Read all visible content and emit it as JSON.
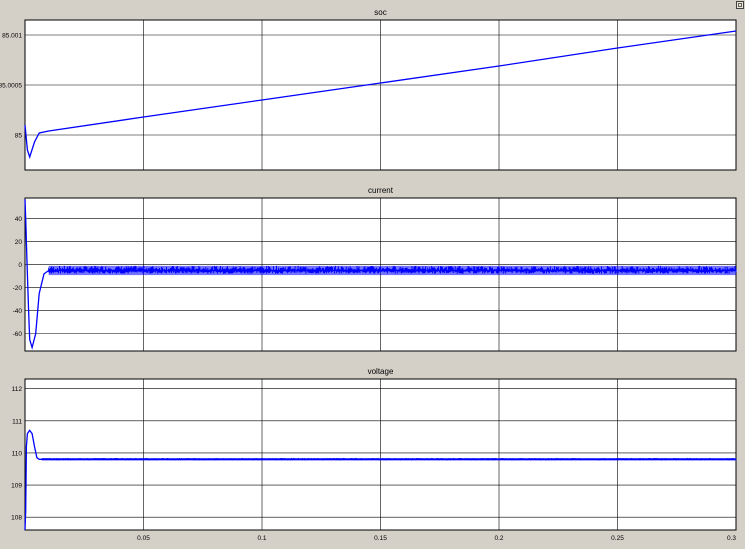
{
  "window": {
    "corner_icon": "restore-icon"
  },
  "colors": {
    "background": "#d4d0c8",
    "plot_bg": "#ffffff",
    "grid": "#000000",
    "trace": "#0000ff"
  },
  "x_ticks": [
    "0.05",
    "0.1",
    "0.15",
    "0.2",
    "0.25",
    "0.3"
  ],
  "chart_data": [
    {
      "type": "line",
      "title": "soc",
      "xlim": [
        0,
        0.3
      ],
      "ylim": [
        84.99965,
        85.00115
      ],
      "yticks": [
        85,
        85.0005,
        85.001
      ],
      "ytick_labels": [
        "85",
        "85.0005",
        "85.001"
      ],
      "grid": true,
      "series": [
        {
          "x": [
            0,
            0.001,
            0.002,
            0.004,
            0.006,
            0.01,
            0.05,
            0.1,
            0.15,
            0.2,
            0.25,
            0.3
          ],
          "y": [
            85.0001,
            84.99985,
            84.99978,
            84.99993,
            85.00002,
            85.00004,
            85.00018,
            85.00035,
            85.00052,
            85.00069,
            85.00087,
            85.00104
          ]
        }
      ]
    },
    {
      "type": "line",
      "title": "current",
      "xlim": [
        0,
        0.3
      ],
      "ylim": [
        -75,
        58
      ],
      "yticks": [
        -60,
        -40,
        -20,
        0,
        20,
        40
      ],
      "ytick_labels": [
        "-60",
        "-40",
        "-20",
        "0",
        "20",
        "40"
      ],
      "grid": true,
      "series": [
        {
          "x": [
            0,
            0.0003,
            0.0008,
            0.0015,
            0.002,
            0.003,
            0.0045,
            0.006,
            0.008,
            0.01,
            0.3
          ],
          "y": [
            57,
            40,
            5,
            -40,
            -65,
            -72,
            -60,
            -25,
            -8,
            -5,
            -5
          ],
          "noise_band": [
            -9,
            -1
          ]
        }
      ]
    },
    {
      "type": "line",
      "title": "voltage",
      "xlim": [
        0,
        0.3
      ],
      "ylim": [
        107.6,
        112.3
      ],
      "yticks": [
        108,
        109,
        110,
        111,
        112
      ],
      "ytick_labels": [
        "108",
        "109",
        "110",
        "111",
        "112"
      ],
      "grid": true,
      "series": [
        {
          "x": [
            0,
            0.0003,
            0.0006,
            0.001,
            0.002,
            0.003,
            0.004,
            0.005,
            0.006,
            0.007,
            0.3
          ],
          "y": [
            107.6,
            108.2,
            110.2,
            110.6,
            110.7,
            110.6,
            110.2,
            109.85,
            109.8,
            109.8,
            109.8
          ],
          "noise_band": [
            109.76,
            109.84
          ]
        }
      ]
    }
  ]
}
